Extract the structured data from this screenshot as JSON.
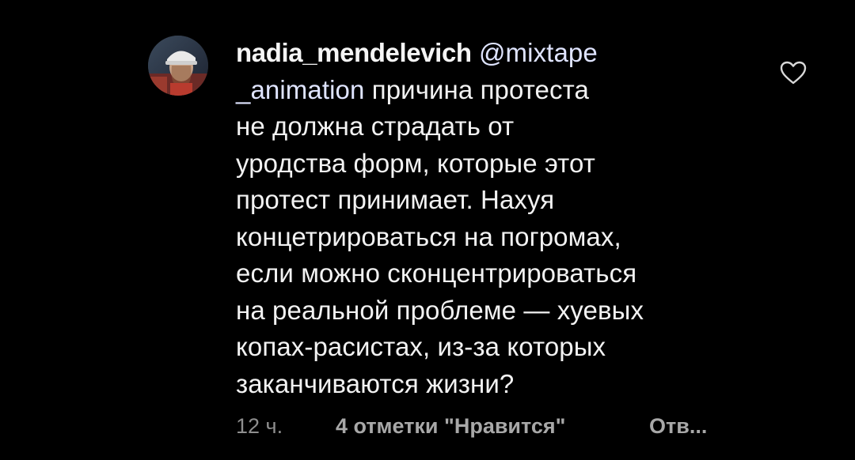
{
  "comment": {
    "username": "nadia_mendelevich",
    "mention_part1": "@mixtape",
    "mention_part2": "_animation",
    "text_lines": [
      "причина протеста",
      "не должна страдать от",
      "уродства форм, которые этот",
      "протест принимает. Нахуя",
      "концетрироваться на погромах,",
      "если можно сконцентрироваться",
      "на реальной проблеме — хуевых",
      "копах-расистах, из-за которых",
      "заканчиваются жизни?"
    ],
    "avatar_icon": "user-avatar-icon",
    "like_icon": "heart-outline-icon"
  },
  "meta": {
    "time": "12 ч.",
    "likes": "4 отметки \"Нравится\"",
    "reply": "Отв..."
  },
  "colors": {
    "background": "#000000",
    "text": "#f2f2f2",
    "mention": "#dfe4ff",
    "meta": "#8e8e8e",
    "heart_stroke": "#d8d8d8"
  }
}
